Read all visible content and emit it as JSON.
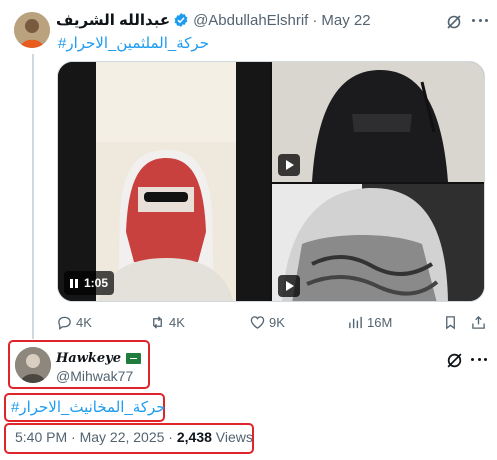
{
  "top_tweet": {
    "author_name": "عبدالله الشريف",
    "handle": "@AbdullahElshrif",
    "separator": "·",
    "date": "May 22",
    "hashtag": "#حركة_الملثمين_الاحرار",
    "media": {
      "video_1_duration": "1:05"
    },
    "actions": {
      "replies": "4K",
      "reposts": "4K",
      "likes": "9K",
      "views": "16M"
    }
  },
  "main_tweet": {
    "author_name": "Hawkeye",
    "handle": "@Mihwak77",
    "hashtag": "#حركة_المخانيث_الاحرار",
    "timestamp": "5:40 PM · May 22, 2025 · ",
    "views_count": "2,438",
    "views_label": "Views"
  },
  "colors": {
    "link": "#1d9bf0",
    "secondary_text": "#536471",
    "highlight_box": "#e0242b",
    "verified_badge": "#1d9bf0"
  },
  "icons": [
    "verified-badge-icon",
    "grok-icon",
    "more-icon",
    "reply-icon",
    "repost-icon",
    "like-icon",
    "views-icon",
    "bookmark-icon",
    "share-icon",
    "play-icon",
    "pause-icon",
    "saudi-flag-icon"
  ]
}
